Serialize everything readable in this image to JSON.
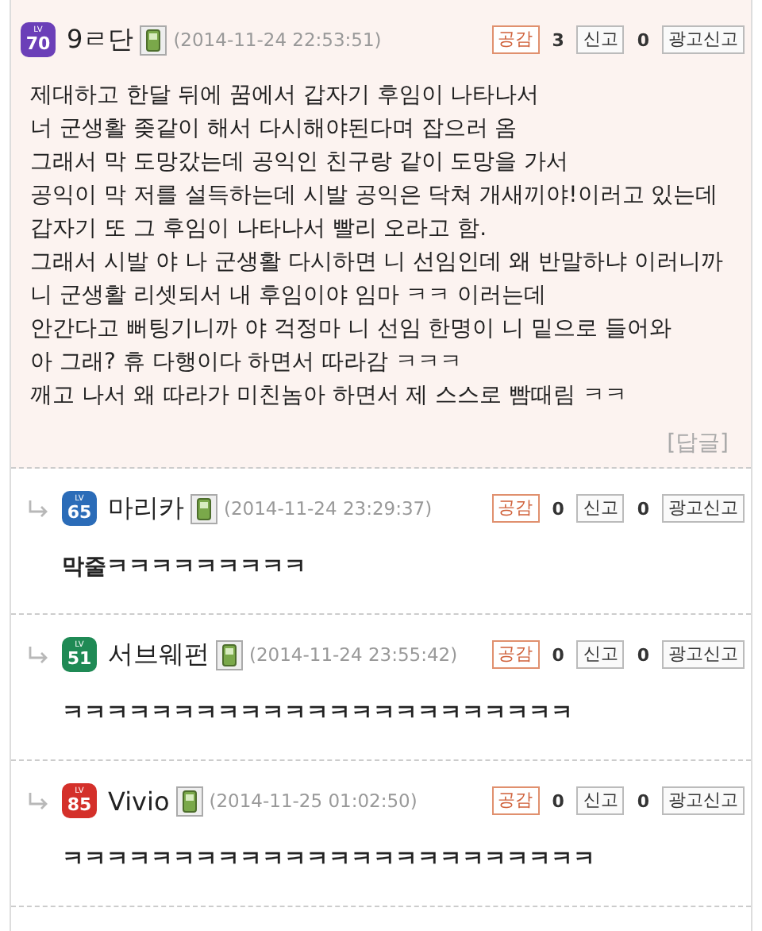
{
  "comments": [
    {
      "kind": "comment",
      "level_badge": {
        "label": "LV",
        "number": "70",
        "color": "#6b3fb8"
      },
      "author": "9ㄹ단",
      "time": "(2014-11-24 22:53:51)",
      "like_label": "공감",
      "like_count": "3",
      "report_label": "신고",
      "report_count": "0",
      "ad_report_label": "광고신고",
      "lines": [
        "제대하고 한달 뒤에 꿈에서 갑자기 후임이 나타나서",
        "너 군생활 좆같이 해서 다시해야된다며 잡으러 옴",
        "그래서 막 도망갔는데 공익인 친구랑 같이 도망을 가서",
        "공익이 막 저를 설득하는데 시발 공익은 닥쳐 개새끼야!이러고 있는데",
        "갑자기 또 그 후임이 나타나서 빨리 오라고 함.",
        "그래서 시발 야 나 군생활 다시하면 니 선임인데 왜 반말하냐 이러니까",
        "니 군생활 리셋되서 내 후임이야 임마 ㅋㅋ 이러는데",
        "안간다고 뻐팅기니까 야 걱정마 니 선임 한명이 니 밑으로 들어와",
        "아 그래? 휴 다행이다 하면서 따라감 ㅋㅋㅋ",
        "깨고 나서 왜 따라가 미친놈아 하면서 제 스스로 빰때림 ㅋㅋ"
      ],
      "reply_label": "[답글]"
    },
    {
      "kind": "reply",
      "level_badge": {
        "label": "LV",
        "number": "65",
        "color": "#2b6cb8"
      },
      "author": "마리카",
      "time": "(2014-11-24 23:29:37)",
      "like_label": "공감",
      "like_count": "0",
      "report_label": "신고",
      "report_count": "0",
      "ad_report_label": "광고신고",
      "lines": [
        "막줄ㅋㅋㅋㅋㅋㅋㅋㅋㅋ"
      ]
    },
    {
      "kind": "reply",
      "level_badge": {
        "label": "LV",
        "number": "51",
        "color": "#1f8a55"
      },
      "author": "서브웨펀",
      "time": "(2014-11-24 23:55:42)",
      "like_label": "공감",
      "like_count": "0",
      "report_label": "신고",
      "report_count": "0",
      "ad_report_label": "광고신고",
      "lines": [
        "ㅋㅋㅋㅋㅋㅋㅋㅋㅋㅋㅋㅋㅋㅋㅋㅋㅋㅋㅋㅋㅋㅋㅋ"
      ]
    },
    {
      "kind": "reply",
      "level_badge": {
        "label": "LV",
        "number": "85",
        "color": "#d4302a"
      },
      "author": "Vivio",
      "time": "(2014-11-25 01:02:50)",
      "like_label": "공감",
      "like_count": "0",
      "report_label": "신고",
      "report_count": "0",
      "ad_report_label": "광고신고",
      "lines": [
        "ㅋㅋㅋㅋㅋㅋㅋㅋㅋㅋㅋㅋㅋㅋㅋㅋㅋㅋㅋㅋㅋㅋㅋㅋ"
      ]
    }
  ]
}
